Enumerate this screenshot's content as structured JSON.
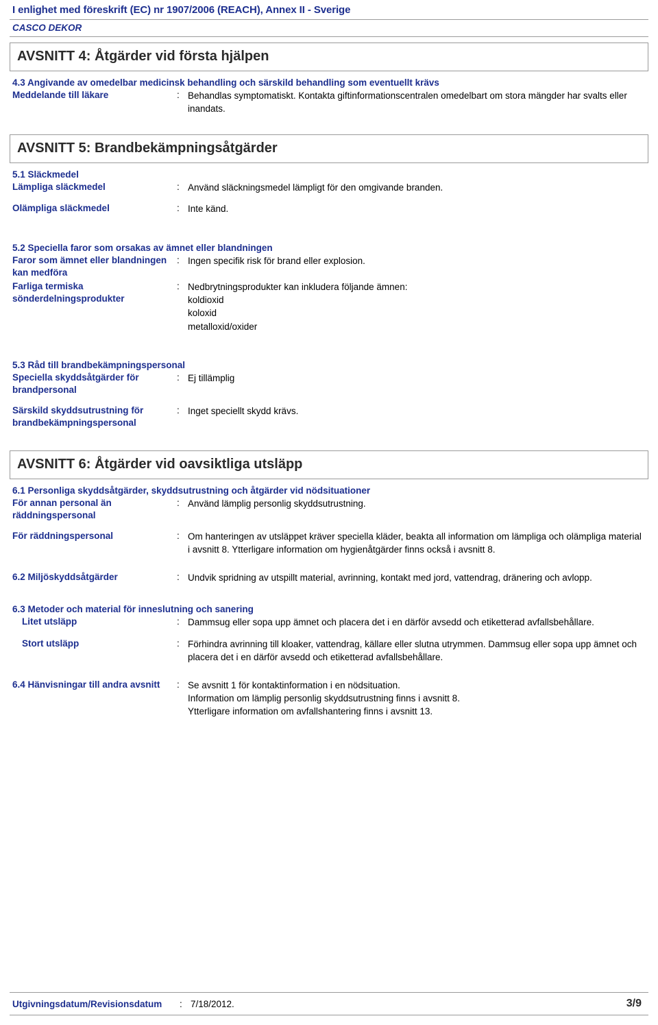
{
  "header": {
    "regulation_line": "I enlighet med föreskrift (EC) nr 1907/2006 (REACH), Annex II - Sverige",
    "product_name": "CASCO DEKOR"
  },
  "sections": [
    {
      "banner": "AVSNITT 4: Åtgärder vid första hjälpen",
      "sub_headings": [
        "4.3 Angivande av omedelbar medicinsk behandling och särskild behandling som eventuellt krävs"
      ],
      "rows": [
        {
          "label": "Meddelande till läkare",
          "colon": ":",
          "value": "Behandlas symptomatiskt. Kontakta giftinformationscentralen omedelbart om stora mängder har svalts eller inandats."
        }
      ]
    },
    {
      "banner": "AVSNITT 5: Brandbekämpningsåtgärder",
      "sub_5_1": "5.1 Släckmedel",
      "row_lampliga": {
        "label": "Lämpliga släckmedel",
        "colon": ":",
        "value": "Använd släckningsmedel lämpligt för den omgivande branden."
      },
      "row_olampliga": {
        "label": "Olämpliga släckmedel",
        "colon": ":",
        "value": "Inte känd."
      },
      "sub_5_2": "5.2 Speciella faror som orsakas av ämnet eller blandningen",
      "row_faror": {
        "label_l1": "Faror som ämnet eller",
        "label_l2": "blandningen kan medföra",
        "colon": ":",
        "value": "Ingen specifik risk för brand eller explosion."
      },
      "row_termiska": {
        "label_l1": "Farliga termiska",
        "label_l2": "sönderdelningsprodukter",
        "colon": ":",
        "value_lines": [
          "Nedbrytningsprodukter kan inkludera följande ämnen:",
          "koldioxid",
          "koloxid",
          "metalloxid/oxider"
        ]
      },
      "sub_5_3": "5.3 Råd till brandbekämpningspersonal",
      "row_speciella": {
        "label_l1": "Speciella skyddsåtgärder",
        "label_l2": "för brandpersonal",
        "colon": ":",
        "value": "Ej tillämplig"
      },
      "row_sarskild": {
        "label_l1": "Särskild skyddsutrustning",
        "label_l2": "för",
        "label_l3": "brandbekämpningspersonal",
        "colon": ":",
        "value": "Inget speciellt skydd krävs."
      }
    },
    {
      "banner": "AVSNITT 6: Åtgärder vid oavsiktliga utsläpp",
      "sub_6_1": "6.1 Personliga skyddsåtgärder, skyddsutrustning och åtgärder vid nödsituationer",
      "row_annan": {
        "label_l1": "För annan personal än",
        "label_l2": "räddningspersonal",
        "colon": ":",
        "value": "Använd lämplig personlig skyddsutrustning."
      },
      "row_raddning": {
        "label": "För räddningspersonal",
        "colon": ":",
        "value": "Om hanteringen av utsläppet kräver speciella kläder, beakta all information om lämpliga och olämpliga material i avsnitt 8. Ytterligare information om hygienåtgärder finns också i avsnitt 8."
      },
      "row_6_2": {
        "label": "6.2 Miljöskyddsåtgärder",
        "colon": ":",
        "value": "Undvik spridning av utspillt material, avrinning, kontakt med jord, vattendrag, dränering och avlopp."
      },
      "sub_6_3": "6.3 Metoder och material för inneslutning och sanering",
      "row_litet": {
        "label": "Litet utsläpp",
        "colon": ":",
        "value": "Dammsug eller sopa upp ämnet och placera det i en därför avsedd och etiketterad avfallsbehållare."
      },
      "row_stort": {
        "label": "Stort utsläpp",
        "colon": ":",
        "value": "Förhindra avrinning till kloaker, vattendrag, källare eller slutna utrymmen. Dammsug eller sopa upp ämnet och placera det i en därför avsedd och etiketterad avfallsbehållare."
      },
      "row_6_4": {
        "label_l1": "6.4 Hänvisningar till andra",
        "label_l2": "avsnitt",
        "colon": ":",
        "value_lines": [
          "Se avsnitt 1 för kontaktinformation i en nödsituation.",
          "Information om lämplig personlig skyddsutrustning finns i avsnitt 8.",
          "Ytterligare information om avfallshantering finns i avsnitt 13."
        ]
      }
    }
  ],
  "footer": {
    "label": "Utgivningsdatum/Revisionsdatum",
    "colon": ":",
    "date": "7/18/2012.",
    "page": "3/9"
  },
  "colors": {
    "heading_blue": "#1d2f8f",
    "rule_gray": "#9a9a9a",
    "body_black": "#000000"
  }
}
